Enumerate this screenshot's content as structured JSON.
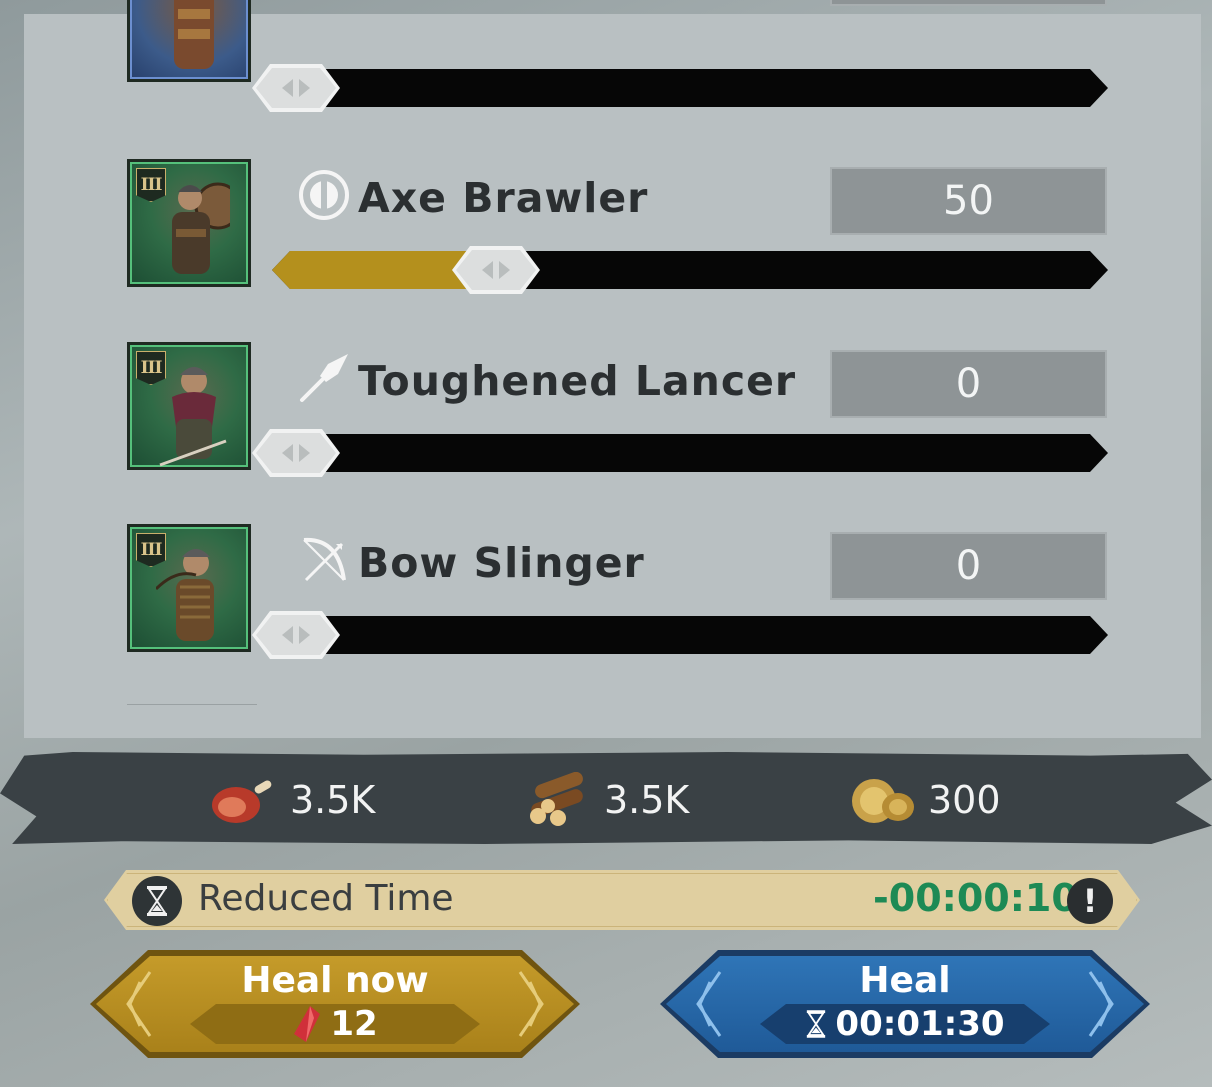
{
  "units": [
    {
      "name": "",
      "tier": "",
      "count": "",
      "slider_fraction": 0
    },
    {
      "name": "Axe Brawler",
      "tier": "III",
      "count": "50",
      "slider_fraction": 0.25,
      "icon": "shield-icon"
    },
    {
      "name": "Toughened Lancer",
      "tier": "III",
      "count": "0",
      "slider_fraction": 0,
      "icon": "spear-icon"
    },
    {
      "name": "Bow Slinger",
      "tier": "III",
      "count": "0",
      "slider_fraction": 0,
      "icon": "bow-icon"
    }
  ],
  "resources": [
    {
      "icon": "meat-icon",
      "value": "3.5K"
    },
    {
      "icon": "wood-icon",
      "value": "3.5K"
    },
    {
      "icon": "gold-icon",
      "value": "300"
    }
  ],
  "reduced_time": {
    "label": "Reduced Time",
    "value": "-00:00:10"
  },
  "buttons": {
    "heal_now": {
      "label": "Heal now",
      "cost": "12"
    },
    "heal": {
      "label": "Heal",
      "time": "00:01:30"
    }
  },
  "colors": {
    "slider_fill": "#b4901d",
    "reduced_value": "#1d8a55",
    "heal_now_bg": "#b88e22",
    "heal_bg": "#2868a8"
  }
}
